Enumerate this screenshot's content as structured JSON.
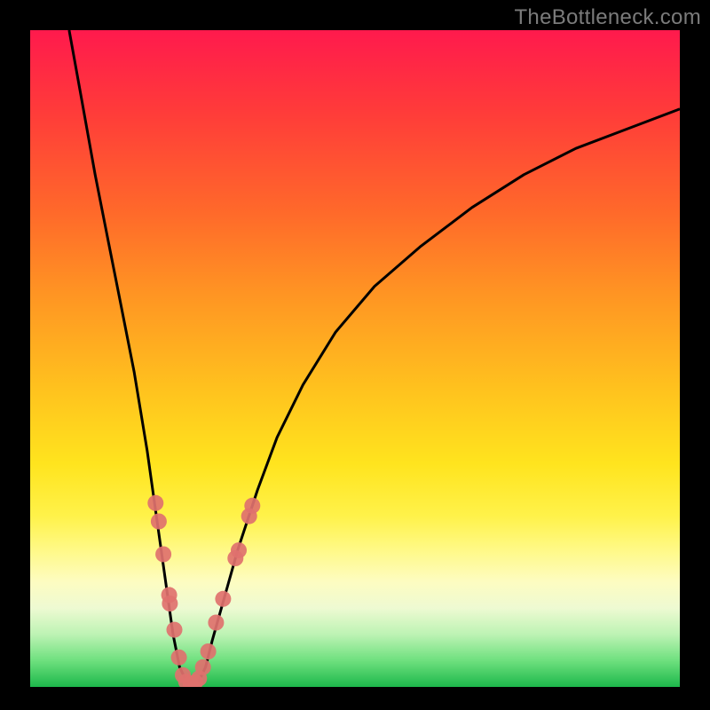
{
  "watermark": "TheBottleneck.com",
  "chart_data": {
    "type": "line",
    "title": "",
    "xlabel": "",
    "ylabel": "",
    "xlim": [
      0,
      100
    ],
    "ylim": [
      0,
      100
    ],
    "series": [
      {
        "name": "curve",
        "x": [
          6,
          8,
          10,
          12,
          14,
          16,
          18,
          19,
          20,
          21,
          22,
          23,
          24,
          25,
          26,
          27,
          28,
          30,
          32,
          35,
          38,
          42,
          47,
          53,
          60,
          68,
          76,
          84,
          92,
          100
        ],
        "y": [
          100,
          89,
          78,
          68,
          58,
          48,
          36,
          29,
          22,
          15,
          8,
          3,
          1,
          0.5,
          1,
          3,
          7,
          14,
          21,
          30,
          38,
          46,
          54,
          61,
          67,
          73,
          78,
          82,
          85,
          88
        ]
      }
    ],
    "markers": [
      {
        "x": 19.3,
        "y": 28.0
      },
      {
        "x": 19.8,
        "y": 25.2
      },
      {
        "x": 20.5,
        "y": 20.2
      },
      {
        "x": 21.4,
        "y": 14.0
      },
      {
        "x": 21.5,
        "y": 12.7
      },
      {
        "x": 22.2,
        "y": 8.7
      },
      {
        "x": 22.9,
        "y": 4.5
      },
      {
        "x": 23.5,
        "y": 1.8
      },
      {
        "x": 24.0,
        "y": 0.8
      },
      {
        "x": 24.7,
        "y": 0.5
      },
      {
        "x": 25.4,
        "y": 0.7
      },
      {
        "x": 26.0,
        "y": 1.3
      },
      {
        "x": 26.6,
        "y": 3.0
      },
      {
        "x": 27.4,
        "y": 5.4
      },
      {
        "x": 28.6,
        "y": 9.8
      },
      {
        "x": 29.7,
        "y": 13.4
      },
      {
        "x": 31.6,
        "y": 19.6
      },
      {
        "x": 32.1,
        "y": 20.8
      },
      {
        "x": 33.7,
        "y": 26.0
      },
      {
        "x": 34.2,
        "y": 27.6
      }
    ],
    "marker_style": {
      "color": "#e0716e",
      "radius_px": 9
    },
    "grid": false,
    "legend": null
  }
}
